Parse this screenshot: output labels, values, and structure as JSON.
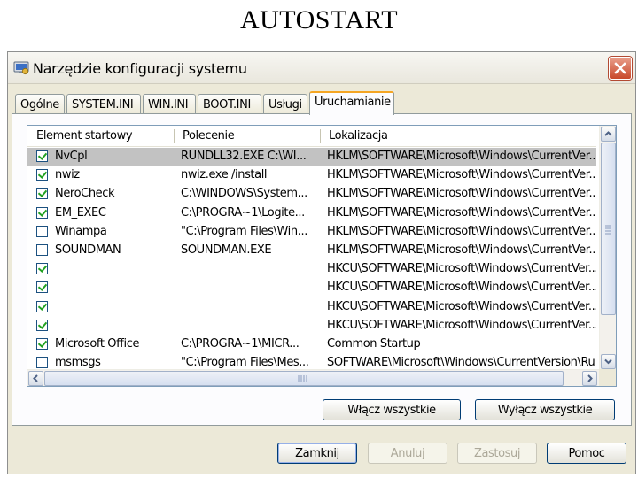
{
  "slide": {
    "title": "AUTOSTART"
  },
  "window": {
    "title": "Narzędzie konfiguracji systemu",
    "close_icon": "close-icon",
    "app_icon": "msconfig-icon"
  },
  "tabs": [
    {
      "label": "Ogólne",
      "active": false
    },
    {
      "label": "SYSTEM.INI",
      "active": false
    },
    {
      "label": "WIN.INI",
      "active": false
    },
    {
      "label": "BOOT.INI",
      "active": false
    },
    {
      "label": "Usługi",
      "active": false
    },
    {
      "label": "Uruchamianie",
      "active": true
    }
  ],
  "startup": {
    "columns": [
      "Element startowy",
      "Polecenie",
      "Lokalizacja"
    ],
    "rows": [
      {
        "checked": true,
        "selected": true,
        "item": "NvCpl",
        "command": "RUNDLL32.EXE C:\\WI...",
        "location": "HKLM\\SOFTWARE\\Microsoft\\Windows\\CurrentVer..."
      },
      {
        "checked": true,
        "selected": false,
        "item": "nwiz",
        "command": "nwiz.exe /install",
        "location": "HKLM\\SOFTWARE\\Microsoft\\Windows\\CurrentVer..."
      },
      {
        "checked": true,
        "selected": false,
        "item": "NeroCheck",
        "command": "C:\\WINDOWS\\System...",
        "location": "HKLM\\SOFTWARE\\Microsoft\\Windows\\CurrentVer..."
      },
      {
        "checked": true,
        "selected": false,
        "item": "EM_EXEC",
        "command": "C:\\PROGRA~1\\Logite...",
        "location": "HKLM\\SOFTWARE\\Microsoft\\Windows\\CurrentVer..."
      },
      {
        "checked": false,
        "selected": false,
        "item": "Winampa",
        "command": "\"C:\\Program Files\\Win...",
        "location": "HKLM\\SOFTWARE\\Microsoft\\Windows\\CurrentVer..."
      },
      {
        "checked": false,
        "selected": false,
        "item": "SOUNDMAN",
        "command": "SOUNDMAN.EXE",
        "location": "HKLM\\SOFTWARE\\Microsoft\\Windows\\CurrentVer..."
      },
      {
        "checked": true,
        "selected": false,
        "item": "",
        "command": "",
        "location": "HKCU\\SOFTWARE\\Microsoft\\Windows\\CurrentVer..."
      },
      {
        "checked": true,
        "selected": false,
        "item": "",
        "command": "",
        "location": "HKCU\\SOFTWARE\\Microsoft\\Windows\\CurrentVer..."
      },
      {
        "checked": true,
        "selected": false,
        "item": "",
        "command": "",
        "location": "HKCU\\SOFTWARE\\Microsoft\\Windows\\CurrentVer..."
      },
      {
        "checked": true,
        "selected": false,
        "item": "",
        "command": "",
        "location": "HKCU\\SOFTWARE\\Microsoft\\Windows\\CurrentVer..."
      },
      {
        "checked": true,
        "selected": false,
        "item": "Microsoft Office",
        "command": "C:\\PROGRA~1\\MICR...",
        "location": "Common Startup"
      },
      {
        "checked": false,
        "selected": false,
        "item": "msmsgs",
        "command": "\"C:\\Program Files\\Mes...",
        "location": "SOFTWARE\\Microsoft\\Windows\\CurrentVersion\\Ru"
      }
    ]
  },
  "panel_buttons": {
    "enable_all": "Włącz wszystkie",
    "disable_all": "Wyłącz wszystkie"
  },
  "dialog_buttons": {
    "close": "Zamknij",
    "cancel": "Anuluj",
    "apply": "Zastosuj",
    "help": "Pomoc"
  }
}
